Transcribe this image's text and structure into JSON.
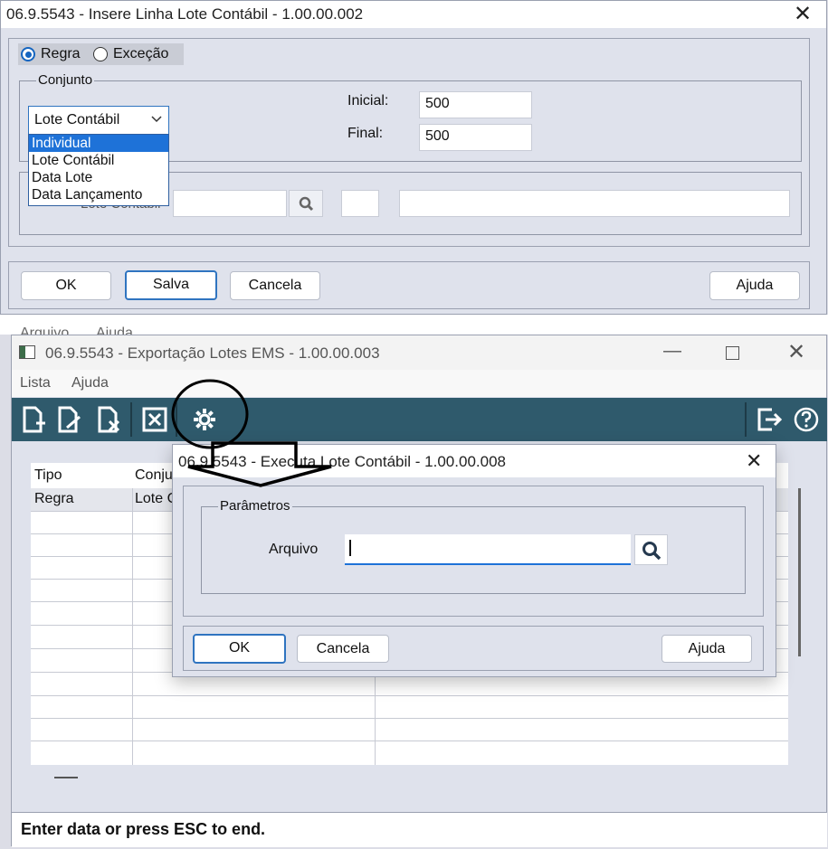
{
  "insert_window": {
    "title": "06.9.5543 - Insere Linha Lote Contábil - 1.00.00.002",
    "close": "✕",
    "radio_regra": "Regra",
    "radio_excecao": "Exceção",
    "group_conjunto": "Conjunto",
    "combo_value": "Lote Contábil",
    "dropdown_options": [
      "Individual",
      "Lote Contábil",
      "Data Lote",
      "Data Lançamento"
    ],
    "hidden_label": "Lote Contábil",
    "inicial_label": "Inicial:",
    "inicial_value": "500",
    "final_label": "Final:",
    "final_value": "500",
    "buttons": {
      "ok": "OK",
      "salva": "Salva",
      "cancela": "Cancela",
      "ajuda": "Ajuda"
    }
  },
  "behind_menu": {
    "arquivo": "Arquivo",
    "ajuda": "Ajuda"
  },
  "export_window": {
    "title": "06.9.5543 - Exportação Lotes EMS - 1.00.00.003",
    "menu": [
      "Lista",
      "Ajuda"
    ],
    "table_headers": [
      "Tipo",
      "Conju"
    ],
    "table_rows": [
      [
        "Regra",
        "Lote C"
      ]
    ],
    "status": "Enter data or press ESC to end."
  },
  "exec_dialog": {
    "title": "06.9.5543 - Executa Lote Contábil - 1.00.00.008",
    "close": "✕",
    "group_parametros": "Parâmetros",
    "arquivo_label": "Arquivo",
    "arquivo_value": "",
    "buttons": {
      "ok": "OK",
      "cancela": "Cancela",
      "ajuda": "Ajuda"
    }
  },
  "colors": {
    "toolbar": "#2f5a6c",
    "accent": "#1e72d8",
    "annotation": "#000000"
  }
}
